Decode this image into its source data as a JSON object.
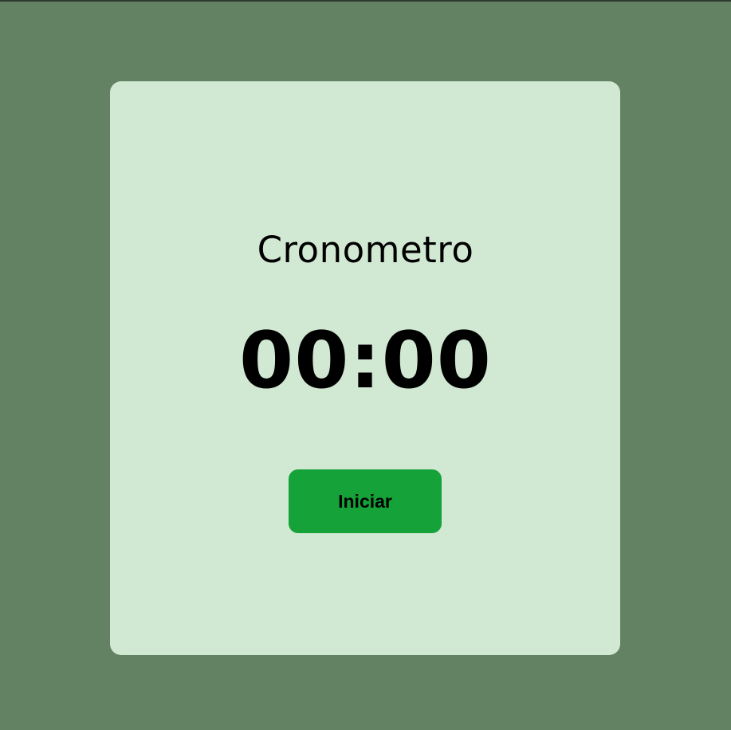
{
  "stopwatch": {
    "title": "Cronometro",
    "time": "00:00",
    "start_label": "Iniciar"
  },
  "colors": {
    "page_background": "#638263",
    "card_background": "#d1e8d3",
    "button_background": "#15a238",
    "text": "#000000"
  }
}
